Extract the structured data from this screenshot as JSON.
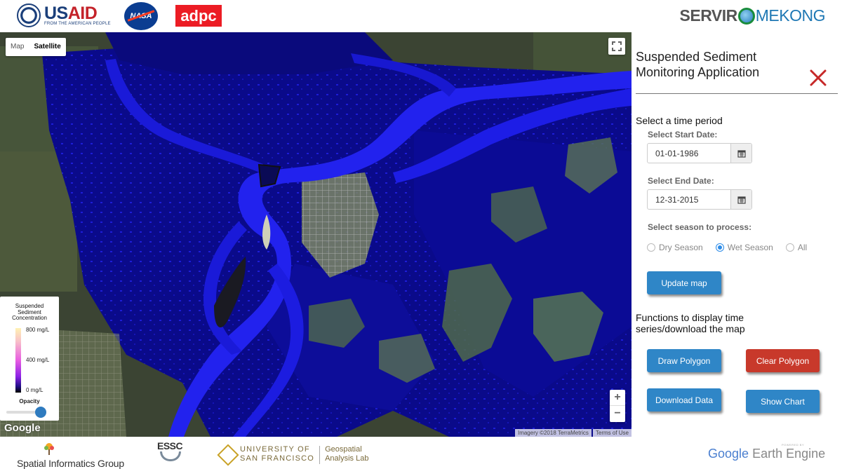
{
  "header": {
    "usaid_name": "USAID",
    "usaid_tagline": "FROM THE AMERICAN PEOPLE",
    "nasa_name": "NASA",
    "adpc_name": "adpc",
    "servir_left": "SERVIR",
    "servir_right": "MEKONG"
  },
  "map": {
    "type_options": [
      "Map",
      "Satellite"
    ],
    "active_type": "Satellite",
    "google_logo": "Google",
    "imagery_credit": "Imagery ©2018 TerraMetrics",
    "terms_link": "Terms of Use",
    "legend": {
      "title_line1": "Suspended",
      "title_line2": "Sediment",
      "title_line3": "Concentration",
      "max_label": "800 mg/L",
      "mid_label": "400 mg/L",
      "min_label": "0 mg/L",
      "opacity_label": "Opacity",
      "opacity_value": 0.9
    },
    "colors": {
      "water": "#1a1adf",
      "deep_water": "#060670",
      "land": "#3d4634",
      "urban": "#7d8765"
    }
  },
  "panel": {
    "title": "Suspended Sediment Monitoring Application",
    "time_section_title": "Select a time period",
    "start_date_label": "Select Start Date:",
    "start_date": "01-01-1986",
    "end_date_label": "Select End Date:",
    "end_date": "12-31-2015",
    "season_label": "Select season to process:",
    "seasons": [
      "Dry Season",
      "Wet Season",
      "All"
    ],
    "selected_season": "Wet Season",
    "update_button": "Update map",
    "functions_title": "Functions to display time series/download the map",
    "draw_polygon_button": "Draw Polygon",
    "clear_polygon_button": "Clear Polygon",
    "download_data_button": "Download Data",
    "show_chart_button": "Show Chart",
    "colors": {
      "blue_button": "#2f86c7",
      "red_button": "#c8392b",
      "close_icon": "#c62828"
    }
  },
  "footer": {
    "sig_name": "Spatial Informatics Group",
    "essc_name": "ESSC",
    "usf_line1": "UNIVERSITY OF",
    "usf_line2": "SAN FRANCISCO",
    "lab_line1": "Geospatial",
    "lab_line2": "Analysis Lab",
    "gee_google": "Google",
    "gee_earth_engine": "Earth Engine",
    "gee_powered": "POWERED BY"
  }
}
